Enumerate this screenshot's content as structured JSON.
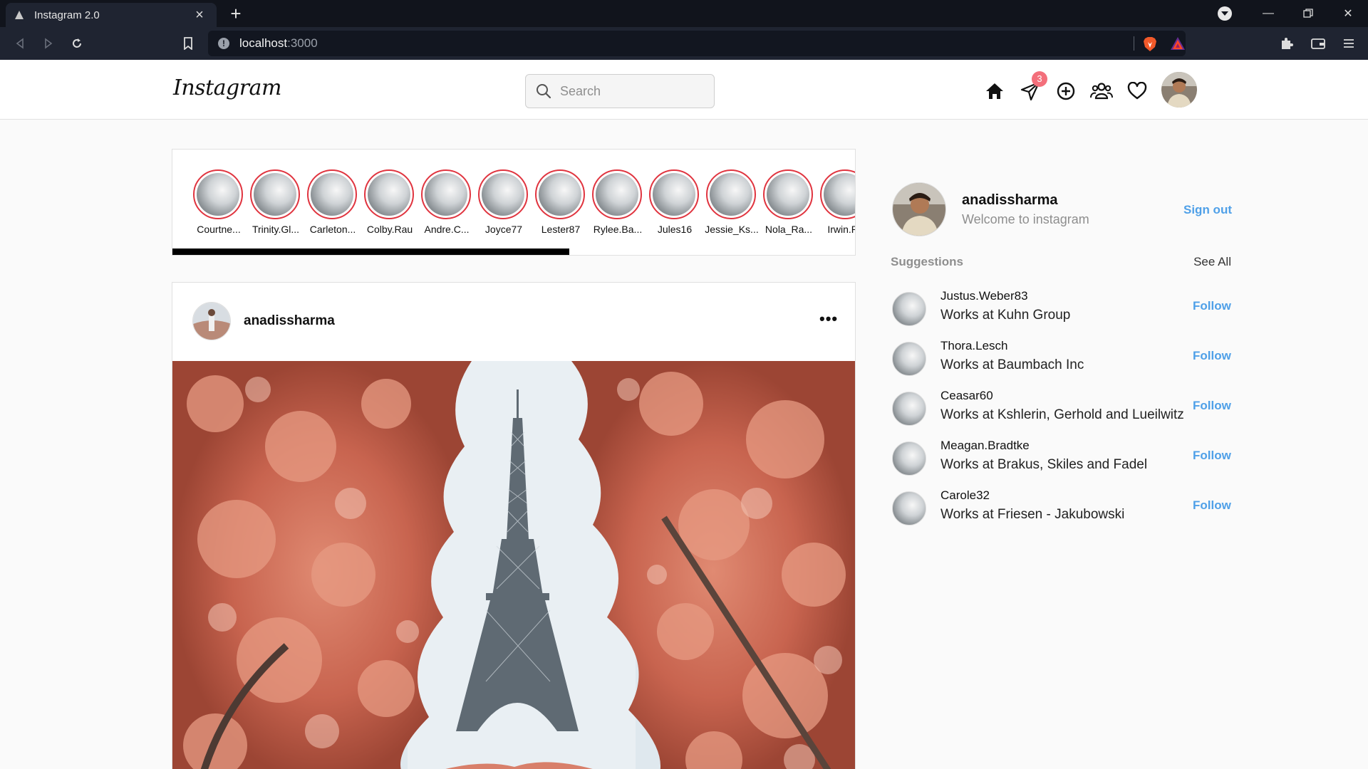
{
  "browser": {
    "tab_title": "Instagram 2.0",
    "new_tab": "+",
    "url_host": "localhost",
    "url_port": ":3000"
  },
  "app": {
    "logo": "Instagram",
    "search_placeholder": "Search",
    "messages_badge": "3",
    "stories": [
      {
        "name": "Courtne..."
      },
      {
        "name": "Trinity.Gl..."
      },
      {
        "name": "Carleton..."
      },
      {
        "name": "Colby.Rau"
      },
      {
        "name": "Andre.C..."
      },
      {
        "name": "Joyce77"
      },
      {
        "name": "Lester87"
      },
      {
        "name": "Rylee.Ba..."
      },
      {
        "name": "Jules16"
      },
      {
        "name": "Jessie_Ks..."
      },
      {
        "name": "Nola_Ra..."
      },
      {
        "name": "Irwin.Ro"
      }
    ],
    "post": {
      "username": "anadissharma",
      "more": "•••"
    },
    "profile": {
      "username": "anadissharma",
      "subtitle": "Welcome to instagram",
      "sign_out": "Sign out"
    },
    "suggestions": {
      "title": "Suggestions",
      "see_all": "See All",
      "follow_label": "Follow",
      "items": [
        {
          "username": "Justus.Weber83",
          "job": "Works at Kuhn Group"
        },
        {
          "username": "Thora.Lesch",
          "job": "Works at Baumbach Inc"
        },
        {
          "username": "Ceasar60",
          "job": "Works at Kshlerin, Gerhold and Lueilwitz"
        },
        {
          "username": "Meagan.Bradtke",
          "job": "Works at Brakus, Skiles and Fadel"
        },
        {
          "username": "Carole32",
          "job": "Works at Friesen - Jakubowski"
        }
      ]
    }
  },
  "colors": {
    "accent": "#4fa0e8",
    "story_ring": "#e0343f",
    "badge": "#f36f7b"
  }
}
